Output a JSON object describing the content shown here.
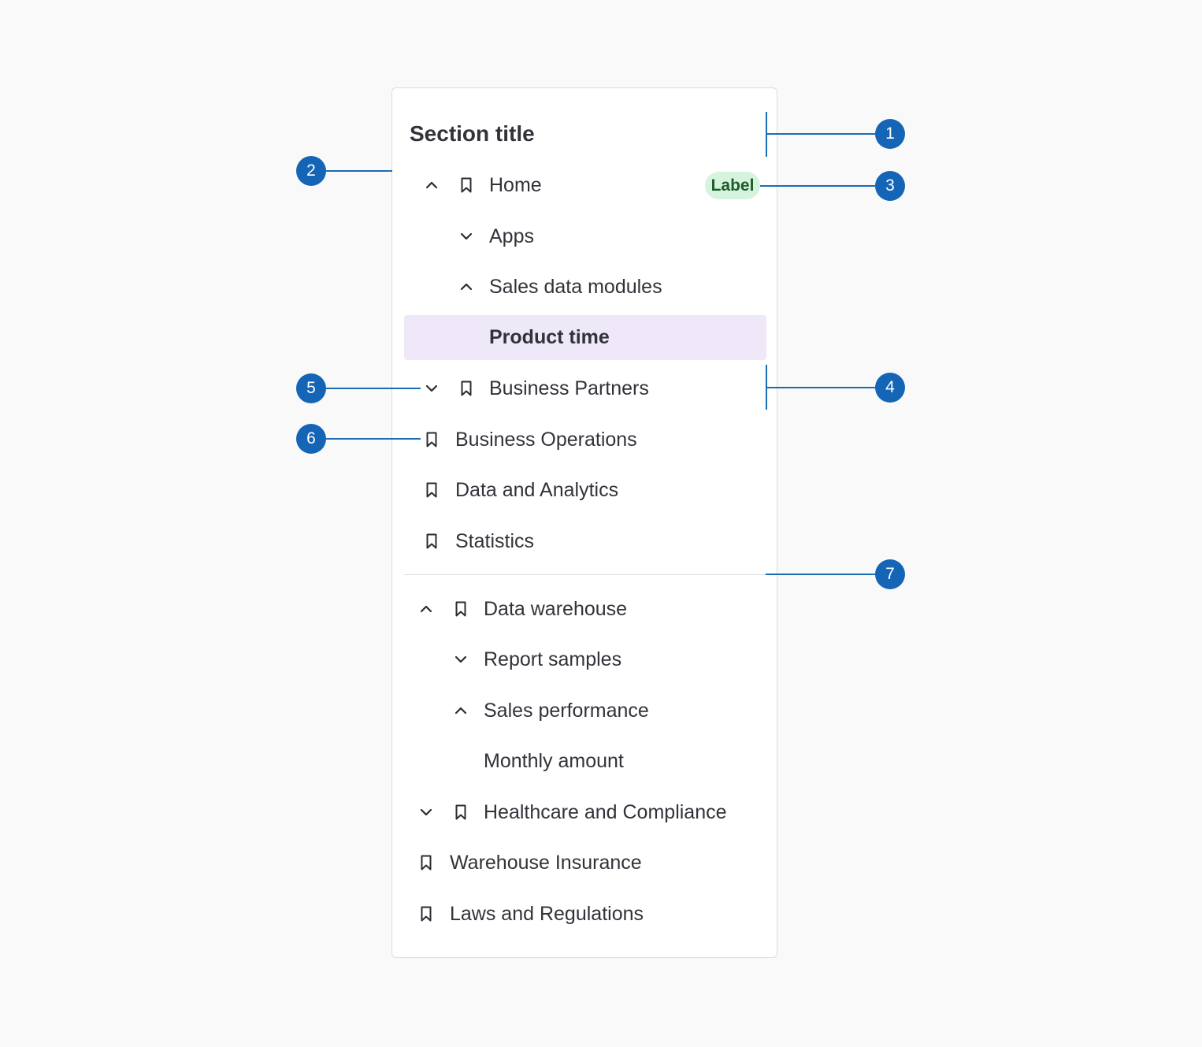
{
  "section_title": "Section title",
  "badge_label": "Label",
  "items": [
    {
      "label": "Home"
    },
    {
      "label": "Apps"
    },
    {
      "label": "Sales data modules"
    },
    {
      "label": "Product time"
    },
    {
      "label": "Business Partners"
    },
    {
      "label": "Business Operations"
    },
    {
      "label": "Data and Analytics"
    },
    {
      "label": "Statistics"
    },
    {
      "label": "Data warehouse"
    },
    {
      "label": "Report samples"
    },
    {
      "label": "Sales performance"
    },
    {
      "label": "Monthly amount"
    },
    {
      "label": "Healthcare and Compliance"
    },
    {
      "label": "Warehouse Insurance"
    },
    {
      "label": "Laws and Regulations"
    }
  ],
  "markers": [
    "1",
    "2",
    "3",
    "4",
    "5",
    "6",
    "7"
  ],
  "colors": {
    "marker": "#1465b5",
    "selected_background": "#efe8f8",
    "badge_background": "#d6f4dd",
    "badge_text": "#1d5e2c"
  }
}
